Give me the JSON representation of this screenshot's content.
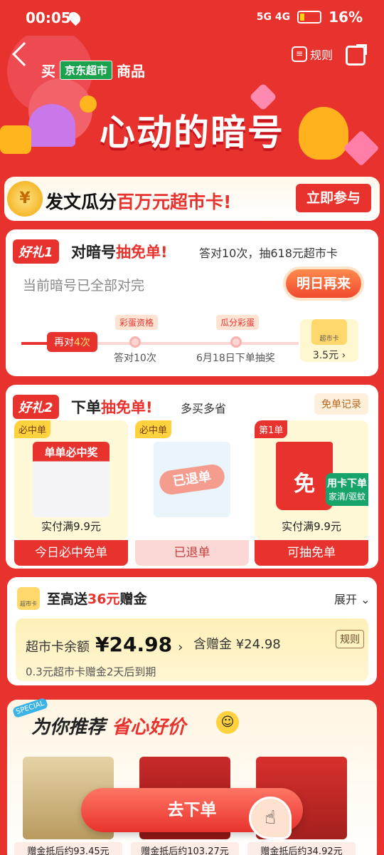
{
  "status_bar": {
    "time": "00:05",
    "network": "5G 4G",
    "battery": "16%"
  },
  "header": {
    "buy_prefix": "买",
    "store_tag": "京东超市",
    "buy_suffix": "商品",
    "rules_label": "规则",
    "title": "心动的暗号"
  },
  "banner": {
    "prefix": "发文瓜分",
    "highlight": "百万元超市卡",
    "suffix": "!",
    "join_button": "立即参与"
  },
  "gift1": {
    "badge": "好礼1",
    "title_prefix": "对暗号",
    "title_highlight": "抽免单",
    "title_suffix": "!",
    "subtitle": "答对10次，抽618元超市卡",
    "status": "当前暗号已全部对完",
    "tomorrow_button": "明日再来",
    "progress": {
      "current_label_prefix": "再对",
      "current_count": "4次",
      "milestones": [
        {
          "tag": "彩蛋资格",
          "label": "答对10次"
        },
        {
          "tag": "瓜分彩蛋",
          "label": "6月18日下单抽奖"
        }
      ],
      "card_label": "超市卡",
      "card_value": "3.5元"
    }
  },
  "gift2": {
    "badge": "好礼2",
    "title_prefix": "下单",
    "title_highlight": "抽免单",
    "title_suffix": "!",
    "subtitle": "多买多省",
    "record_button": "免单记录",
    "products": [
      {
        "tag": "必中单",
        "image_caption": "单单必中奖",
        "price": "实付满9.9元",
        "button": "今日必中免单"
      },
      {
        "tag": "必中单",
        "image_caption": "已退单",
        "price": "",
        "button": "已退单"
      },
      {
        "tag": "第1单",
        "image_caption": "免",
        "overlay": "用卡下单",
        "overlay_sub": "家清/驱蚊",
        "price": "实付满9.9元",
        "button": "可抽免单"
      }
    ]
  },
  "supermarket": {
    "icon_label": "超市卡",
    "title_prefix": "至高送",
    "title_highlight": "36元",
    "title_suffix": "赠金",
    "expand": "展开",
    "balance_label": "超市卡余额",
    "balance_value": "¥24.98",
    "gift_label": "含赠金",
    "gift_value": "¥24.98",
    "rule": "规则",
    "expire_note": "0.3元超市卡赠金2天后到期"
  },
  "recommend": {
    "special": "SPECIAL",
    "title_prefix": "为你推荐",
    "title_highlight": "省心好价",
    "items": [
      {
        "label": "赠金抵后约93.45元"
      },
      {
        "label": "赠金抵后约103.27元"
      },
      {
        "label": "赠金抵后约34.92元"
      }
    ]
  },
  "order_button": "去下单",
  "colors": {
    "primary": "#e8322e",
    "gold": "#ffd23e",
    "cream": "#fff8d6",
    "green": "#1aa24d"
  }
}
